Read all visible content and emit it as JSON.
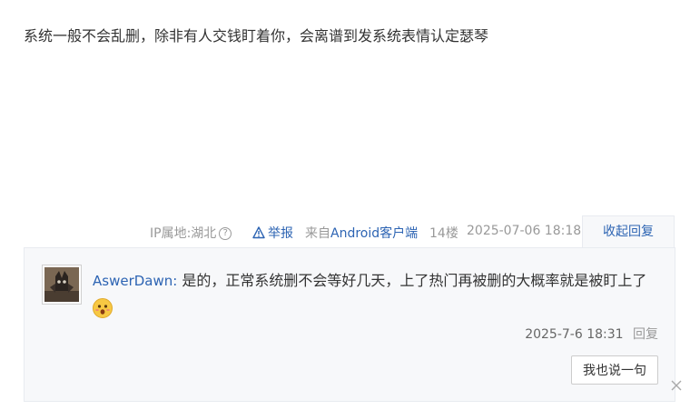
{
  "post": {
    "text": "系统一般不会乱删，除非有人交钱盯着你，会离谱到发系统表情认定瑟琴"
  },
  "meta": {
    "ip_label": "IP属地:湖北",
    "help_glyph": "?",
    "report_label": "举报",
    "from_prefix": "来自",
    "from_client": "Android客户端",
    "floor": "14楼",
    "datetime": "2025-07-06 18:18",
    "collapse_label": "收起回复"
  },
  "reply": {
    "author": "AswerDawn:",
    "text": "是的，正常系统删不会等好几天，上了热门再被删的大概率就是被盯上了",
    "time": "2025-7-6 18:31",
    "reply_label": "回复",
    "say_button": "我也说一句"
  },
  "colors": {
    "link": "#2d64b3",
    "muted": "#999999",
    "reply_bg": "#f7f8fa"
  },
  "icons": {
    "help": "help-circle-icon",
    "report": "warning-triangle-icon",
    "emoji": "surprised-face-icon",
    "close": "close-icon"
  }
}
